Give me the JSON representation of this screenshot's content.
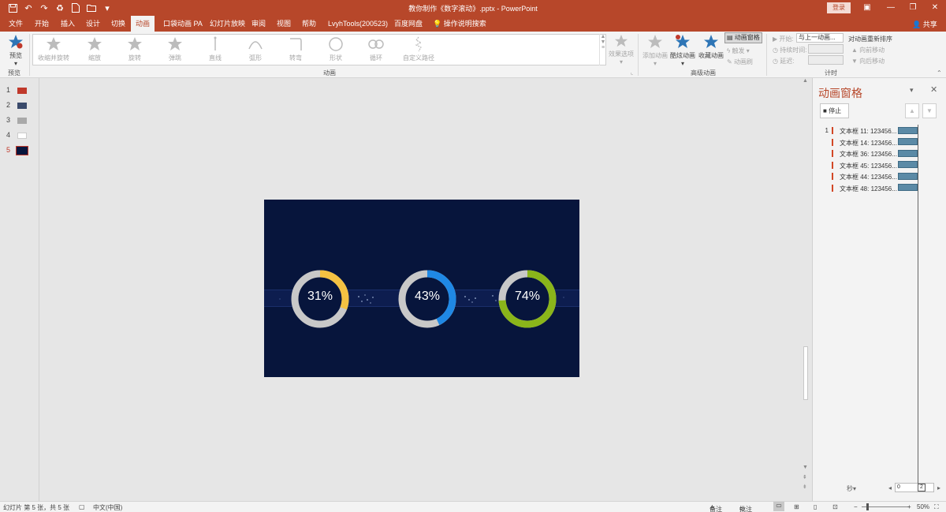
{
  "window": {
    "title": "教你制作《数字滚动》.pptx - PowerPoint",
    "login": "登录",
    "share": "共享"
  },
  "tabs": [
    "文件",
    "开始",
    "插入",
    "设计",
    "切换",
    "动画",
    "口袋动画 PA",
    "幻灯片放映",
    "审阅",
    "视图",
    "帮助",
    "LvyhTools(200523)",
    "百度网盘",
    "操作说明搜索"
  ],
  "active_tab": "动画",
  "ribbon": {
    "preview": {
      "label": "预览",
      "group": "预览"
    },
    "gallery": [
      {
        "label": "收缩并旋转",
        "icon": "star-spin-icon"
      },
      {
        "label": "缩放",
        "icon": "star-zoom-icon"
      },
      {
        "label": "旋转",
        "icon": "star-rotate-icon"
      },
      {
        "label": "弹跳",
        "icon": "star-bounce-icon"
      },
      {
        "label": "直线",
        "icon": "line-path-icon"
      },
      {
        "label": "弧形",
        "icon": "arc-path-icon"
      },
      {
        "label": "转弯",
        "icon": "turn-path-icon"
      },
      {
        "label": "形状",
        "icon": "shape-path-icon"
      },
      {
        "label": "循环",
        "icon": "loop-path-icon"
      },
      {
        "label": "自定义路径",
        "icon": "custom-path-icon"
      }
    ],
    "effect_options": "效果选项",
    "anim_group": "动画",
    "add_animation": "添加动画",
    "cool_animation": "酷炫动画",
    "fav_animation": "收藏动画",
    "anim_pane": "动画窗格",
    "trigger": "触发",
    "anim_painter": "动画刷",
    "advanced_group": "高级动画",
    "start_label": "开始:",
    "start_value": "与上一动画...",
    "duration_label": "持续时间:",
    "delay_label": "延迟:",
    "reorder": "对动画重新排序",
    "move_earlier": "向前移动",
    "move_later": "向后移动",
    "timing_group": "计时"
  },
  "slides": {
    "numbers": [
      "1",
      "2",
      "3",
      "4",
      "5"
    ],
    "current": "5"
  },
  "slide": {
    "rings": [
      {
        "label": "31%",
        "value": 31,
        "color": "#f5c242"
      },
      {
        "label": "43%",
        "value": 43,
        "color": "#1f88e5"
      },
      {
        "label": "74%",
        "value": 74,
        "color": "#8ab51a"
      }
    ],
    "ring_track_color": "#c8c8c8",
    "background_color": "#07153c"
  },
  "animation_pane": {
    "title": "动画窗格",
    "stop": "停止",
    "items": [
      {
        "num": "1",
        "text": "文本框 11: 123456..."
      },
      {
        "num": "",
        "text": "文本框 14: 123456..."
      },
      {
        "num": "",
        "text": "文本框 36: 123456..."
      },
      {
        "num": "",
        "text": "文本框 45: 123456..."
      },
      {
        "num": "",
        "text": "文本框 44: 123456..."
      },
      {
        "num": "",
        "text": "文本框 48: 123456..."
      }
    ],
    "timeline_start": "0",
    "timeline_end": "2"
  },
  "status": {
    "slide_info": "幻灯片 第 5 张，共 5 张",
    "language": "中文(中国)",
    "notes": "备注",
    "comments": "批注",
    "zoom": "50%"
  }
}
